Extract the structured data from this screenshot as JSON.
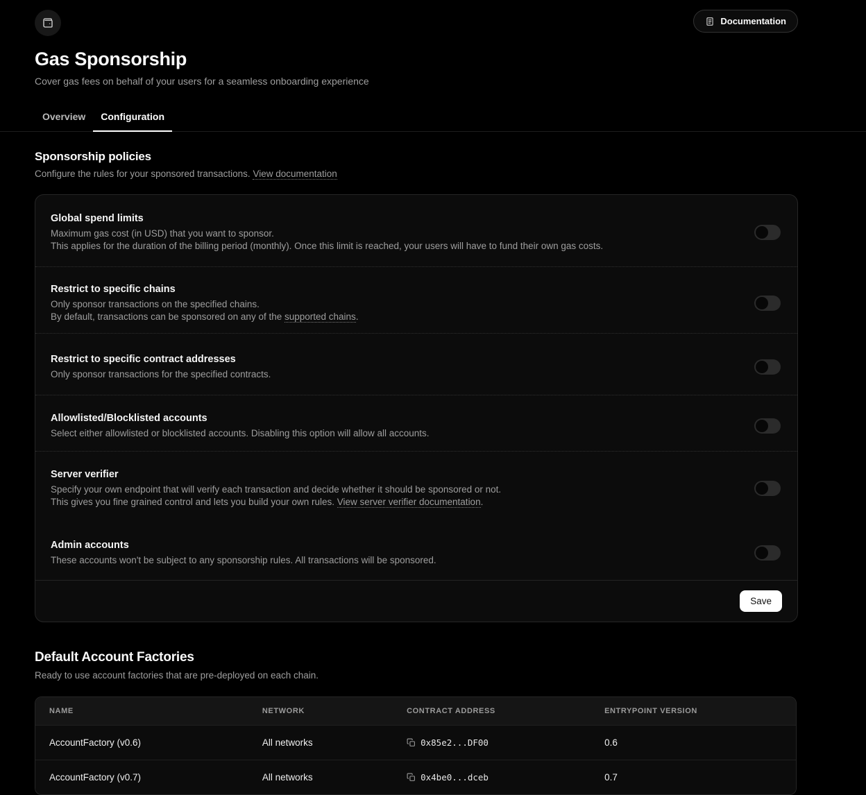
{
  "header": {
    "title": "Gas Sponsorship",
    "subtitle": "Cover gas fees on behalf of your users for a seamless onboarding experience",
    "documentation_button": "Documentation",
    "tabs": [
      {
        "label": "Overview",
        "active": false
      },
      {
        "label": "Configuration",
        "active": true
      }
    ],
    "icons": {
      "app": "wallet-icon",
      "documentation": "document-icon"
    }
  },
  "policies": {
    "heading": "Sponsorship policies",
    "description": "Configure the rules for your sponsored transactions.",
    "doc_link": "View documentation",
    "save_label": "Save",
    "toggle_state_all": "off",
    "items": [
      {
        "title": "Global spend limits",
        "line1": "Maximum gas cost (in USD) that you want to sponsor.",
        "line2": "This applies for the duration of the billing period (monthly). Once this limit is reached, your users will have to fund their own gas costs.",
        "enabled": false
      },
      {
        "title": "Restrict to specific chains",
        "line1": "Only sponsor transactions on the specified chains.",
        "line2_pre": "By default, transactions can be sponsored on any of the ",
        "line2_link": "supported chains",
        "line2_post": ".",
        "enabled": false
      },
      {
        "title": "Restrict to specific contract addresses",
        "line1": "Only sponsor transactions for the specified contracts.",
        "enabled": false
      },
      {
        "title": "Allowlisted/Blocklisted accounts",
        "line1": "Select either allowlisted or blocklisted accounts. Disabling this option will allow all accounts.",
        "enabled": false
      },
      {
        "title": "Server verifier",
        "line1": "Specify your own endpoint that will verify each transaction and decide whether it should be sponsored or not.",
        "line2_pre": "This gives you fine grained control and lets you build your own rules. ",
        "line2_link": "View server verifier documentation",
        "line2_post": ".",
        "enabled": false
      },
      {
        "title": "Admin accounts",
        "line1": "These accounts won't be subject to any sponsorship rules. All transactions will be sponsored.",
        "enabled": false
      }
    ]
  },
  "factories": {
    "heading": "Default Account Factories",
    "description": "Ready to use account factories that are pre-deployed on each chain.",
    "columns": {
      "name": "Name",
      "network": "Network",
      "contract": "Contract address",
      "entrypoint": "Entrypoint version"
    },
    "rows": [
      {
        "name": "AccountFactory (v0.6)",
        "network": "All networks",
        "contract": "0x85e2...DF00",
        "entrypoint": "0.6"
      },
      {
        "name": "AccountFactory (v0.7)",
        "network": "All networks",
        "contract": "0x4be0...dceb",
        "entrypoint": "0.7"
      }
    ]
  },
  "colors": {
    "background": "#000000",
    "card_background": "#0c0c0c",
    "border": "#262626",
    "text_primary": "#fafafa",
    "text_muted": "#9e9e9e",
    "toggle_track": "#2b2b2b",
    "save_button_bg": "#ffffff"
  }
}
